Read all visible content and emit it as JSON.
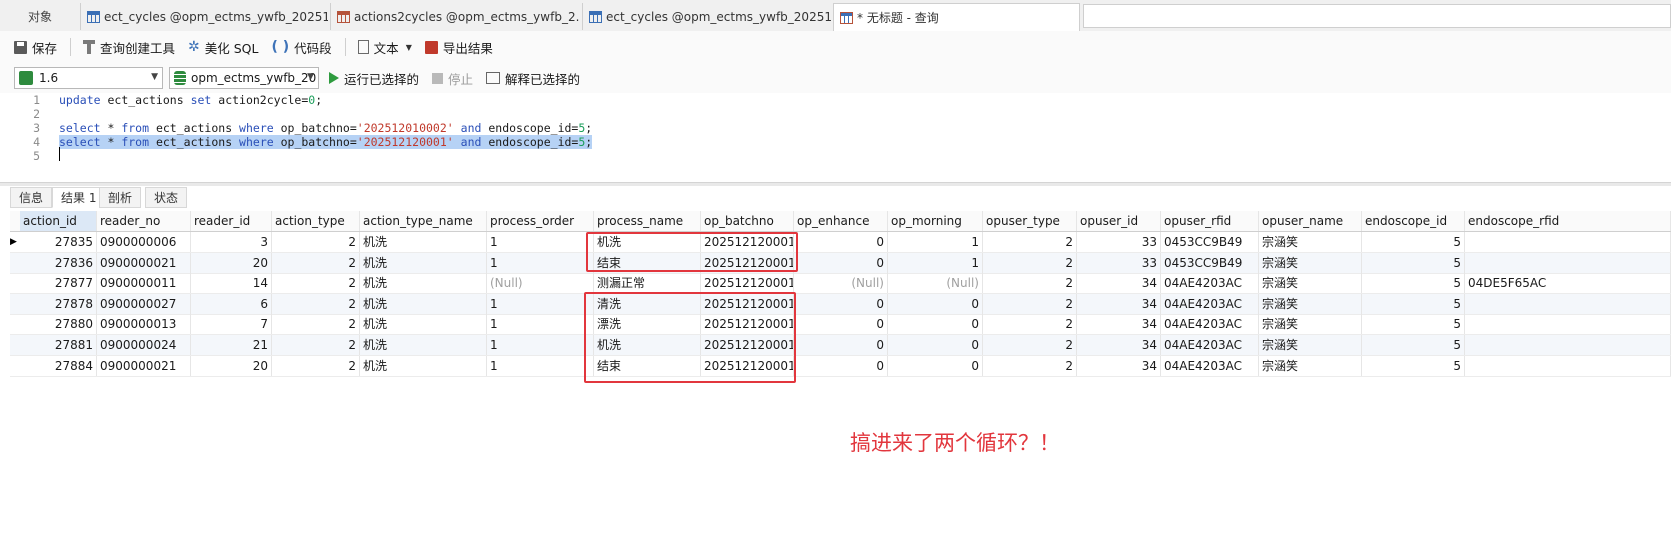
{
  "tabs": {
    "objects": "对象",
    "items": [
      {
        "label": "ect_cycles @opm_ectms_ywfb_20251...",
        "icon": "table-icon"
      },
      {
        "label": "actions2cycles @opm_ectms_ywfb_2...",
        "icon": "view-icon"
      },
      {
        "label": "ect_cycles @opm_ectms_ywfb_20251...",
        "icon": "table-icon"
      },
      {
        "label": "* 无标题 - 查询",
        "icon": "query-icon"
      }
    ]
  },
  "toolbar": {
    "save": "保存",
    "query_builder": "查询创建工具",
    "beautify": "美化 SQL",
    "snippet": "代码段",
    "text": "文本",
    "export": "导出结果"
  },
  "row2": {
    "connection": "1.6",
    "database": "opm_ectms_ywfb_20",
    "run_selected": "运行已选择的",
    "stop": "停止",
    "explain_selected": "解释已选择的"
  },
  "editor": {
    "line_numbers": [
      "1",
      "2",
      "3",
      "4",
      "5"
    ],
    "lines": [
      [
        {
          "t": "update",
          "c": "kw"
        },
        {
          "t": " ect_actions ",
          "c": ""
        },
        {
          "t": "set",
          "c": "kw"
        },
        {
          "t": " action2cycle=",
          "c": ""
        },
        {
          "t": "0",
          "c": "numlit"
        },
        {
          "t": ";",
          "c": ""
        }
      ],
      [],
      [
        {
          "t": "select",
          "c": "kw"
        },
        {
          "t": " * ",
          "c": ""
        },
        {
          "t": "from",
          "c": "kw"
        },
        {
          "t": " ect_actions ",
          "c": ""
        },
        {
          "t": "where",
          "c": "kw"
        },
        {
          "t": " op_batchno=",
          "c": ""
        },
        {
          "t": "'202512010002'",
          "c": "str"
        },
        {
          "t": " ",
          "c": ""
        },
        {
          "t": "and",
          "c": "kw"
        },
        {
          "t": " endoscope_id=",
          "c": ""
        },
        {
          "t": "5",
          "c": "numlit"
        },
        {
          "t": ";",
          "c": ""
        }
      ],
      [
        {
          "t": "select",
          "c": "kw"
        },
        {
          "t": " * ",
          "c": ""
        },
        {
          "t": "from",
          "c": "kw"
        },
        {
          "t": " ect_actions ",
          "c": ""
        },
        {
          "t": "where",
          "c": "kw"
        },
        {
          "t": " op_batchno=",
          "c": ""
        },
        {
          "t": "'202512120001'",
          "c": "str"
        },
        {
          "t": " ",
          "c": ""
        },
        {
          "t": "and",
          "c": "kw"
        },
        {
          "t": " endoscope_id=",
          "c": ""
        },
        {
          "t": "5",
          "c": "numlit"
        },
        {
          "t": ";",
          "c": ""
        }
      ],
      []
    ]
  },
  "result_tabs": [
    "信息",
    "结果 1",
    "剖析",
    "状态"
  ],
  "grid": {
    "columns": [
      "action_id",
      "reader_no",
      "reader_id",
      "action_type",
      "action_type_name",
      "process_order",
      "process_name",
      "op_batchno",
      "op_enhance",
      "op_morning",
      "opuser_type",
      "opuser_id",
      "opuser_rfid",
      "opuser_name",
      "endoscope_id",
      "endoscope_rfid"
    ],
    "rows": [
      [
        "27835",
        "0900000006",
        "3",
        "2",
        "机洗",
        "1",
        "机洗",
        "202512120001",
        "0",
        "1",
        "2",
        "33",
        "0453CC9B49",
        "宗涵笑",
        "5",
        ""
      ],
      [
        "27836",
        "0900000021",
        "20",
        "2",
        "机洗",
        "1",
        "结束",
        "202512120001",
        "0",
        "1",
        "2",
        "33",
        "0453CC9B49",
        "宗涵笑",
        "5",
        ""
      ],
      [
        "27877",
        "0900000011",
        "14",
        "2",
        "机洗",
        "(Null)",
        "测漏正常",
        "202512120001",
        "(Null)",
        "(Null)",
        "2",
        "34",
        "04AE4203AC",
        "宗涵笑",
        "5",
        "04DE5F65AC"
      ],
      [
        "27878",
        "0900000027",
        "6",
        "2",
        "机洗",
        "1",
        "清洗",
        "202512120001",
        "0",
        "0",
        "2",
        "34",
        "04AE4203AC",
        "宗涵笑",
        "5",
        ""
      ],
      [
        "27880",
        "0900000013",
        "7",
        "2",
        "机洗",
        "1",
        "漂洗",
        "202512120001",
        "0",
        "0",
        "2",
        "34",
        "04AE4203AC",
        "宗涵笑",
        "5",
        ""
      ],
      [
        "27881",
        "0900000024",
        "21",
        "2",
        "机洗",
        "1",
        "机洗",
        "202512120001",
        "0",
        "0",
        "2",
        "34",
        "04AE4203AC",
        "宗涵笑",
        "5",
        ""
      ],
      [
        "27884",
        "0900000021",
        "20",
        "2",
        "机洗",
        "1",
        "结束",
        "202512120001",
        "0",
        "0",
        "2",
        "34",
        "04AE4203AC",
        "宗涵笑",
        "5",
        ""
      ]
    ]
  },
  "annotation": "搞进来了两个循环？！",
  "colors": {
    "highlight": "#e2363d",
    "selection": "#b6d2f5",
    "keyword": "#2a4fb8",
    "string": "#c0392b"
  }
}
